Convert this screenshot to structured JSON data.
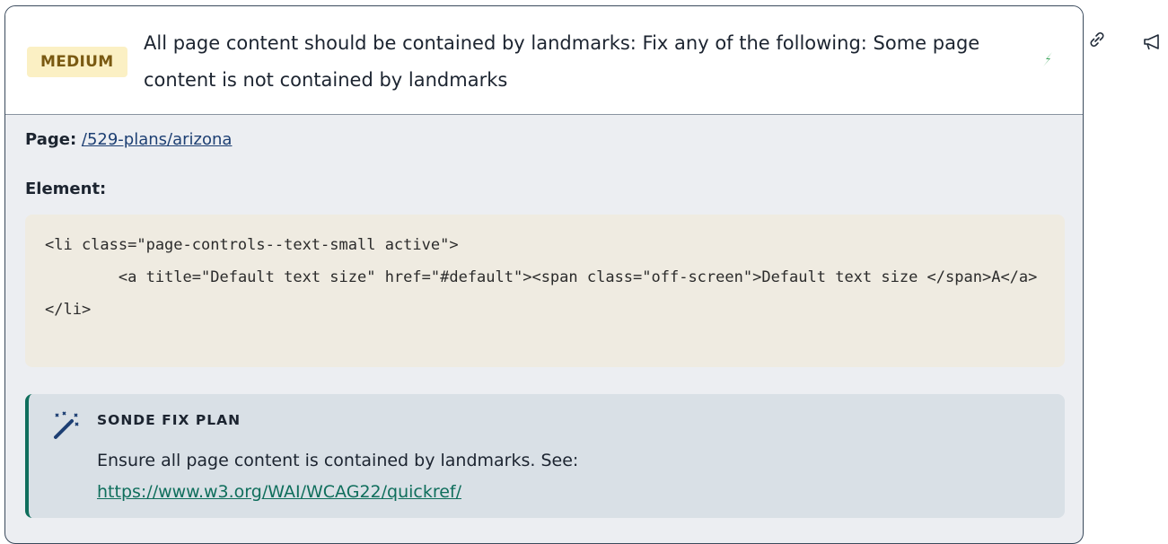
{
  "issue": {
    "severity": "MEDIUM",
    "title": "All page content should be contained by landmarks: Fix any of the following: Some page content is not contained by landmarks",
    "page_label": "Page:",
    "page_link": "/529-plans/arizona",
    "element_label": "Element:",
    "element_code": "<li class=\"page-controls--text-small active\">\n        <a title=\"Default text size\" href=\"#default\"><span class=\"off-screen\">Default text size </span>A</a>\n</li>"
  },
  "fix_plan": {
    "heading": "SONDE FIX PLAN",
    "text": "Ensure all page content is contained by landmarks. See:",
    "link": "https://www.w3.org/WAI/WCAG22/quickref/"
  },
  "colors": {
    "severity_bg": "#fbf0c4",
    "severity_text": "#7a5a12",
    "accent": "#0f6e5c",
    "link": "#1d3f73",
    "code_bg": "#efebe1",
    "fix_bg": "#d9e0e6"
  },
  "icons": [
    "bolt-icon",
    "magic-wand-icon",
    "link-icon",
    "megaphone-icon"
  ]
}
